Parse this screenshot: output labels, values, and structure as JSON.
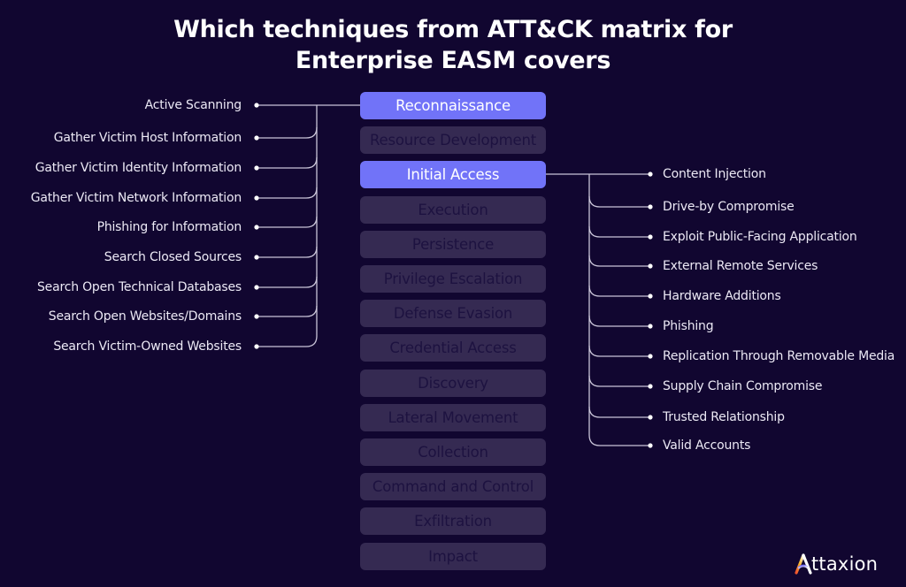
{
  "title": {
    "line1": "Which techniques from ATT&CK matrix for",
    "line2": "Enterprise EASM covers"
  },
  "colors": {
    "background": "#110630",
    "active_tactic": "#7173f8",
    "inactive_tactic": "#352a52",
    "inactive_text": "#1d1240",
    "connector": "#c9c4d8"
  },
  "tactics": [
    {
      "label": "Reconnaissance",
      "active": true
    },
    {
      "label": "Resource Development",
      "active": false
    },
    {
      "label": "Initial Access",
      "active": true
    },
    {
      "label": "Execution",
      "active": false
    },
    {
      "label": "Persistence",
      "active": false
    },
    {
      "label": "Privilege Escalation",
      "active": false
    },
    {
      "label": "Defense Evasion",
      "active": false
    },
    {
      "label": "Credential Access",
      "active": false
    },
    {
      "label": "Discovery",
      "active": false
    },
    {
      "label": "Lateral Movement",
      "active": false
    },
    {
      "label": "Collection",
      "active": false
    },
    {
      "label": "Command and Control",
      "active": false
    },
    {
      "label": "Exfiltration",
      "active": false
    },
    {
      "label": "Impact",
      "active": false
    }
  ],
  "reconnaissance_techniques": [
    "Active Scanning",
    "Gather Victim Host Information",
    "Gather Victim Identity Information",
    "Gather Victim Network Information",
    "Phishing for Information",
    "Search Closed Sources",
    "Search Open Technical Databases",
    "Search Open Websites/Domains",
    "Search Victim-Owned Websites"
  ],
  "initial_access_techniques": [
    "Content Injection",
    "Drive-by Compromise",
    "Exploit Public-Facing Application",
    "External Remote Services",
    "Hardware Additions",
    "Phishing",
    "Replication Through Removable Media",
    "Supply Chain Compromise",
    "Trusted Relationship",
    "Valid Accounts"
  ],
  "logo": {
    "text": "ttaxion",
    "icon": "attaxion-logo-icon"
  }
}
